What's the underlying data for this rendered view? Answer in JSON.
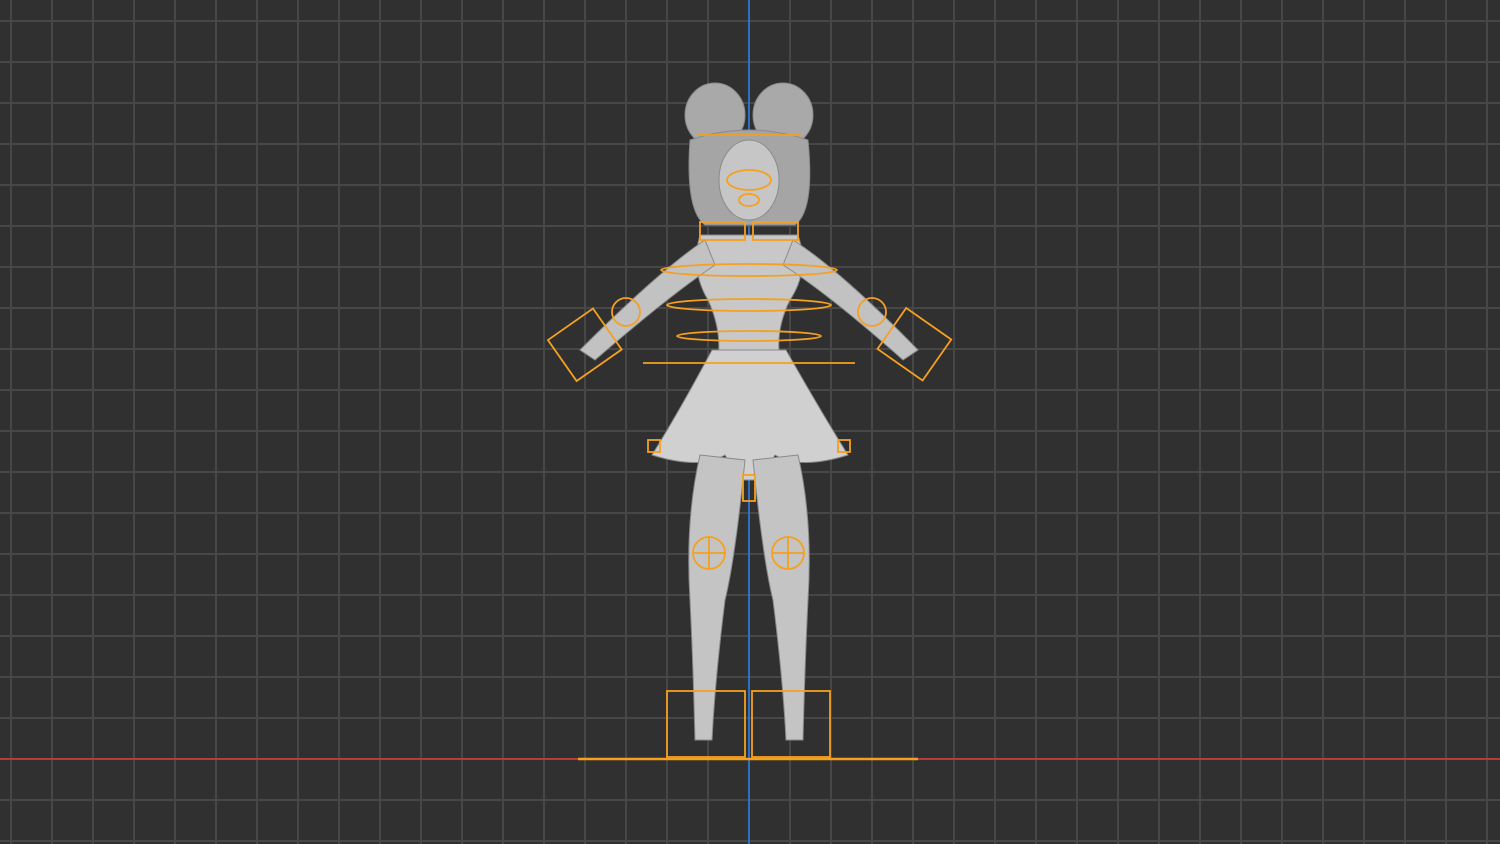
{
  "viewport": {
    "view": "front-orthographic",
    "colors": {
      "background": "#303030",
      "grid": "#474747",
      "x_axis": "#c0392b",
      "z_axis": "#2e6fc0",
      "rig": "#f5a020",
      "mesh": "#c8c8c8"
    },
    "objects": [
      {
        "name": "character-mesh",
        "icon": "mesh-icon"
      },
      {
        "name": "armature-rig",
        "icon": "armature-icon"
      }
    ]
  }
}
